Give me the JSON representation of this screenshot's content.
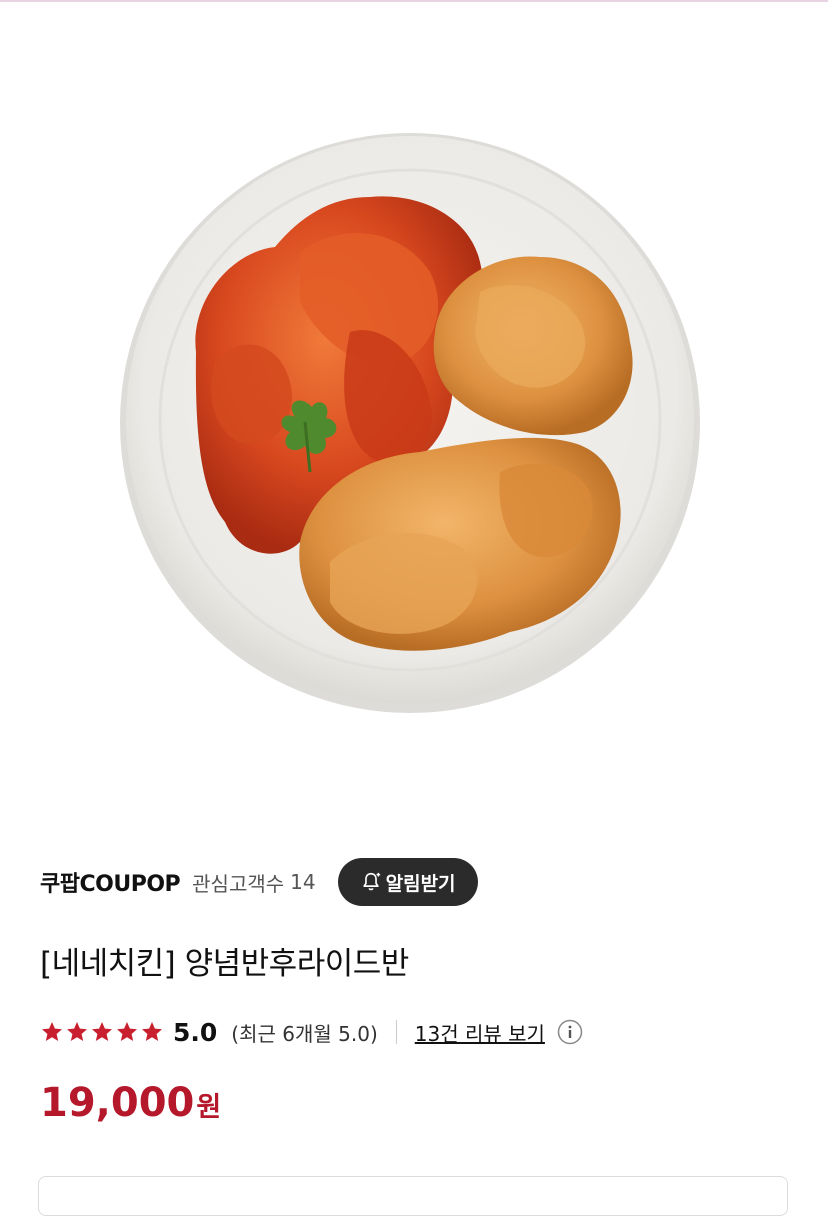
{
  "product": {
    "image_alt": "chicken-plate-photo",
    "seller": {
      "name": "쿠팝COUPOP",
      "fans_label": "관심고객수",
      "fans_count": "14",
      "alert_button_label": "알림받기"
    },
    "title": "[네네치킨] 양념반후라이드반",
    "rating": {
      "stars": 5,
      "value": "5.0",
      "recent": "(최근 6개월 5.0)",
      "review_link": "13건 리뷰 보기"
    },
    "price": {
      "amount": "19,000",
      "unit": "원"
    }
  },
  "colors": {
    "accent": "#b5172b",
    "star": "#c8202e",
    "button_bg": "#2b2b2b"
  }
}
